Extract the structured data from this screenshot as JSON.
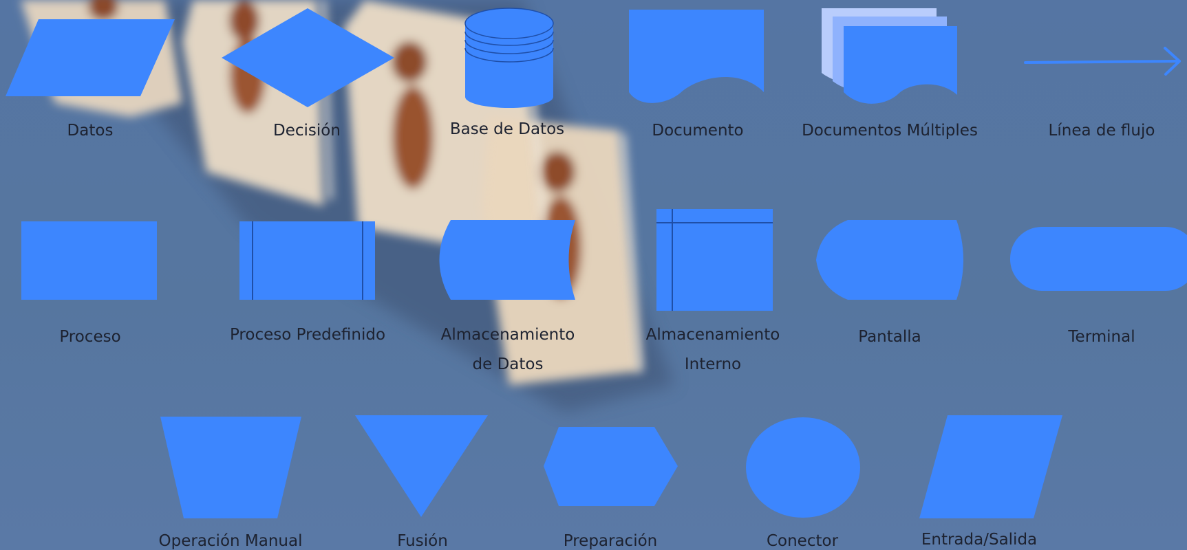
{
  "colors": {
    "shape_fill": "#3d86fe",
    "shape_stroke": "#1f4fa8",
    "label_text": "#1d2230",
    "background": "#56769f",
    "stack_back": "#b9cdfc",
    "stack_middle": "#8fb2fd"
  },
  "symbols": {
    "datos": "Datos",
    "decision": "Decisión",
    "base_de_datos": "Base de Datos",
    "documento": "Documento",
    "documentos_multiples": "Documentos Múltiples",
    "linea_de_flujo": "Línea de flujo",
    "proceso": "Proceso",
    "proceso_predefinido": "Proceso Predefinido",
    "almacenamiento_datos_line1": "Almacenamiento",
    "almacenamiento_datos_line2": "de Datos",
    "almacenamiento_interno_line1": "Almacenamiento",
    "almacenamiento_interno_line2": "Interno",
    "pantalla": "Pantalla",
    "terminal": "Terminal",
    "operacion_manual": "Operación Manual",
    "fusion": "Fusión",
    "preparacion": "Preparación",
    "conector": "Conector",
    "entrada_salida": "Entrada/Salida"
  },
  "icons": {
    "background": "blurred-photo-figures-background",
    "flow_arrow": "arrow-right-icon"
  }
}
